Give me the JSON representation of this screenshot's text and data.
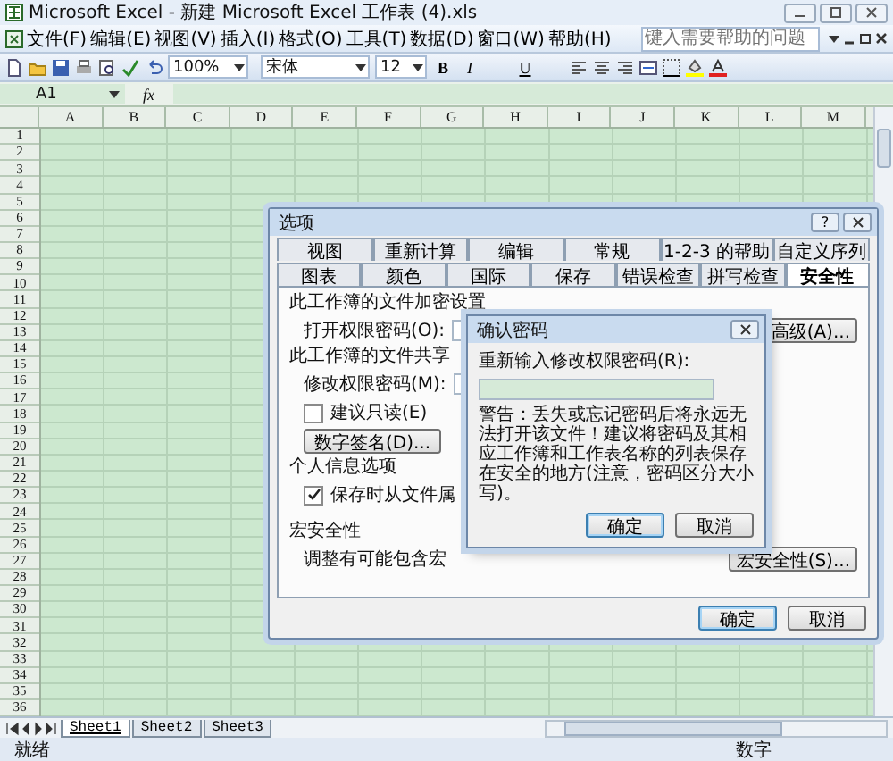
{
  "window": {
    "title": "Microsoft Excel - 新建 Microsoft Excel 工作表 (4).xls"
  },
  "menu": {
    "items": [
      "文件(F)",
      "编辑(E)",
      "视图(V)",
      "插入(I)",
      "格式(O)",
      "工具(T)",
      "数据(D)",
      "窗口(W)",
      "帮助(H)"
    ],
    "help_placeholder": "键入需要帮助的问题"
  },
  "toolbar": {
    "zoom": "100%",
    "font": "宋体",
    "size": "12",
    "format_buttons": [
      "B",
      "I",
      "U"
    ]
  },
  "formula_bar": {
    "cell": "A1",
    "fx": "fx"
  },
  "sheet": {
    "columns": [
      "A",
      "B",
      "C",
      "D",
      "E",
      "F",
      "G",
      "H",
      "I",
      "J",
      "K",
      "L",
      "M"
    ],
    "rows": [
      "1",
      "2",
      "3",
      "4",
      "5",
      "6",
      "7",
      "8",
      "9",
      "10",
      "11",
      "12",
      "13",
      "14",
      "15",
      "16",
      "17",
      "18",
      "19",
      "20",
      "21",
      "22",
      "23",
      "24",
      "25",
      "26",
      "27",
      "28",
      "29",
      "30",
      "31",
      "32",
      "33",
      "34",
      "35",
      "36"
    ]
  },
  "sheet_tabs": [
    {
      "label": "Sheet1",
      "selected": true
    },
    {
      "label": "Sheet2",
      "selected": false
    },
    {
      "label": "Sheet3",
      "selected": false
    }
  ],
  "status_bar": {
    "left": "就绪",
    "right": "数字"
  },
  "options_dialog": {
    "title": "选项",
    "help_button": "?",
    "tab_rows": [
      [
        {
          "label": "视图",
          "selected": false
        },
        {
          "label": "重新计算",
          "selected": false
        },
        {
          "label": "编辑",
          "selected": false
        },
        {
          "label": "常规",
          "selected": false
        },
        {
          "label": "1-2-3 的帮助",
          "selected": false
        },
        {
          "label": "自定义序列",
          "selected": false
        }
      ],
      [
        {
          "label": "图表",
          "selected": false
        },
        {
          "label": "颜色",
          "selected": false
        },
        {
          "label": "国际",
          "selected": false
        },
        {
          "label": "保存",
          "selected": false
        },
        {
          "label": "错误检查",
          "selected": false
        },
        {
          "label": "拼写检查",
          "selected": false
        },
        {
          "label": "安全性",
          "selected": true
        }
      ]
    ],
    "encrypt_heading": "此工作簿的文件加密设置",
    "open_password_label": "打开权限密码(O):",
    "advanced_button": "高级(A)...",
    "share_heading": "此工作簿的文件共享",
    "modify_password_label": "修改权限密码(M):",
    "read_only": {
      "label": "建议只读(E)",
      "checked": false
    },
    "signature_button": "数字签名(D)...",
    "privacy_heading": "个人信息选项",
    "remove_info": {
      "label": "保存时从文件属",
      "checked": true
    },
    "macro_heading": "宏安全性",
    "macro_text": "调整有可能包含宏",
    "macro_button": "宏安全性(S)...",
    "buttons": [
      "确定",
      "取消"
    ]
  },
  "confirm_dialog": {
    "title": "确认密码",
    "field_label": "重新输入修改权限密码(R):",
    "warning": "警告：丢失或忘记密码后将永远无法打开该文件！建议将密码及其相应工作簿和工作表名称的列表保存在安全的地方(注意，密码区分大小写)。",
    "buttons": [
      "确定",
      "取消"
    ]
  }
}
